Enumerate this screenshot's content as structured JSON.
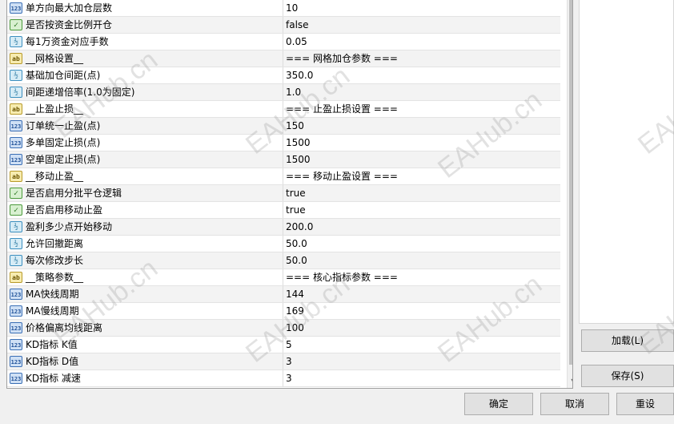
{
  "params": [
    {
      "icon": "int",
      "label": "单方向最大加仓层数",
      "value": "10"
    },
    {
      "icon": "bool",
      "label": "是否按资金比例开仓",
      "value": "false"
    },
    {
      "icon": "dbl",
      "label": "每1万资金对应手数",
      "value": "0.05"
    },
    {
      "icon": "str",
      "label": "__网格设置__",
      "value": "=== 网格加仓参数 ==="
    },
    {
      "icon": "dbl",
      "label": "基础加仓间距(点)",
      "value": "350.0"
    },
    {
      "icon": "dbl",
      "label": "间距递增倍率(1.0为固定)",
      "value": "1.0"
    },
    {
      "icon": "str",
      "label": "__止盈止损__",
      "value": "=== 止盈止损设置 ==="
    },
    {
      "icon": "int",
      "label": "订单统一止盈(点)",
      "value": "150"
    },
    {
      "icon": "int",
      "label": "多单固定止损(点)",
      "value": "1500"
    },
    {
      "icon": "int",
      "label": "空单固定止损(点)",
      "value": "1500"
    },
    {
      "icon": "str",
      "label": "__移动止盈__",
      "value": "=== 移动止盈设置 ==="
    },
    {
      "icon": "bool",
      "label": "是否启用分批平仓逻辑",
      "value": "true"
    },
    {
      "icon": "bool",
      "label": "是否启用移动止盈",
      "value": "true"
    },
    {
      "icon": "dbl",
      "label": "盈利多少点开始移动",
      "value": "200.0"
    },
    {
      "icon": "dbl",
      "label": "允许回撤距离",
      "value": "50.0"
    },
    {
      "icon": "dbl",
      "label": "每次修改步长",
      "value": "50.0"
    },
    {
      "icon": "str",
      "label": "__策略参数__",
      "value": "=== 核心指标参数 ==="
    },
    {
      "icon": "int",
      "label": "MA快线周期",
      "value": "144"
    },
    {
      "icon": "int",
      "label": "MA慢线周期",
      "value": "169"
    },
    {
      "icon": "int",
      "label": "价格偏离均线距离",
      "value": "100"
    },
    {
      "icon": "int",
      "label": "KD指标 K值",
      "value": "5"
    },
    {
      "icon": "int",
      "label": "KD指标 D值",
      "value": "3"
    },
    {
      "icon": "int",
      "label": "KD指标 减速",
      "value": "3"
    }
  ],
  "icon_glyphs": {
    "int": "123",
    "dbl": "½",
    "bool": "✓",
    "str": "ab"
  },
  "buttons": {
    "load": "加载(L)",
    "save": "保存(S)",
    "ok": "确定",
    "cancel": "取消",
    "reset": "重设"
  },
  "watermark": "EAHub.cn"
}
